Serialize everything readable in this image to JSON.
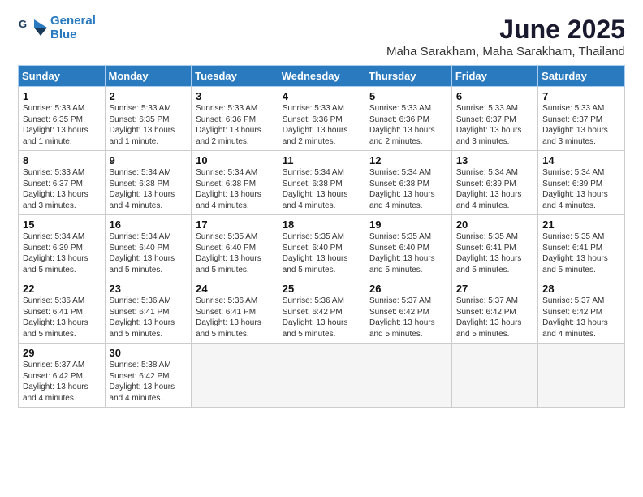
{
  "logo": {
    "line1": "General",
    "line2": "Blue"
  },
  "title": "June 2025",
  "location": "Maha Sarakham, Maha Sarakham, Thailand",
  "headers": [
    "Sunday",
    "Monday",
    "Tuesday",
    "Wednesday",
    "Thursday",
    "Friday",
    "Saturday"
  ],
  "weeks": [
    [
      {
        "day": "1",
        "detail": "Sunrise: 5:33 AM\nSunset: 6:35 PM\nDaylight: 13 hours\nand 1 minute."
      },
      {
        "day": "2",
        "detail": "Sunrise: 5:33 AM\nSunset: 6:35 PM\nDaylight: 13 hours\nand 1 minute."
      },
      {
        "day": "3",
        "detail": "Sunrise: 5:33 AM\nSunset: 6:36 PM\nDaylight: 13 hours\nand 2 minutes."
      },
      {
        "day": "4",
        "detail": "Sunrise: 5:33 AM\nSunset: 6:36 PM\nDaylight: 13 hours\nand 2 minutes."
      },
      {
        "day": "5",
        "detail": "Sunrise: 5:33 AM\nSunset: 6:36 PM\nDaylight: 13 hours\nand 2 minutes."
      },
      {
        "day": "6",
        "detail": "Sunrise: 5:33 AM\nSunset: 6:37 PM\nDaylight: 13 hours\nand 3 minutes."
      },
      {
        "day": "7",
        "detail": "Sunrise: 5:33 AM\nSunset: 6:37 PM\nDaylight: 13 hours\nand 3 minutes."
      }
    ],
    [
      {
        "day": "8",
        "detail": "Sunrise: 5:33 AM\nSunset: 6:37 PM\nDaylight: 13 hours\nand 3 minutes."
      },
      {
        "day": "9",
        "detail": "Sunrise: 5:34 AM\nSunset: 6:38 PM\nDaylight: 13 hours\nand 4 minutes."
      },
      {
        "day": "10",
        "detail": "Sunrise: 5:34 AM\nSunset: 6:38 PM\nDaylight: 13 hours\nand 4 minutes."
      },
      {
        "day": "11",
        "detail": "Sunrise: 5:34 AM\nSunset: 6:38 PM\nDaylight: 13 hours\nand 4 minutes."
      },
      {
        "day": "12",
        "detail": "Sunrise: 5:34 AM\nSunset: 6:38 PM\nDaylight: 13 hours\nand 4 minutes."
      },
      {
        "day": "13",
        "detail": "Sunrise: 5:34 AM\nSunset: 6:39 PM\nDaylight: 13 hours\nand 4 minutes."
      },
      {
        "day": "14",
        "detail": "Sunrise: 5:34 AM\nSunset: 6:39 PM\nDaylight: 13 hours\nand 4 minutes."
      }
    ],
    [
      {
        "day": "15",
        "detail": "Sunrise: 5:34 AM\nSunset: 6:39 PM\nDaylight: 13 hours\nand 5 minutes."
      },
      {
        "day": "16",
        "detail": "Sunrise: 5:34 AM\nSunset: 6:40 PM\nDaylight: 13 hours\nand 5 minutes."
      },
      {
        "day": "17",
        "detail": "Sunrise: 5:35 AM\nSunset: 6:40 PM\nDaylight: 13 hours\nand 5 minutes."
      },
      {
        "day": "18",
        "detail": "Sunrise: 5:35 AM\nSunset: 6:40 PM\nDaylight: 13 hours\nand 5 minutes."
      },
      {
        "day": "19",
        "detail": "Sunrise: 5:35 AM\nSunset: 6:40 PM\nDaylight: 13 hours\nand 5 minutes."
      },
      {
        "day": "20",
        "detail": "Sunrise: 5:35 AM\nSunset: 6:41 PM\nDaylight: 13 hours\nand 5 minutes."
      },
      {
        "day": "21",
        "detail": "Sunrise: 5:35 AM\nSunset: 6:41 PM\nDaylight: 13 hours\nand 5 minutes."
      }
    ],
    [
      {
        "day": "22",
        "detail": "Sunrise: 5:36 AM\nSunset: 6:41 PM\nDaylight: 13 hours\nand 5 minutes."
      },
      {
        "day": "23",
        "detail": "Sunrise: 5:36 AM\nSunset: 6:41 PM\nDaylight: 13 hours\nand 5 minutes."
      },
      {
        "day": "24",
        "detail": "Sunrise: 5:36 AM\nSunset: 6:41 PM\nDaylight: 13 hours\nand 5 minutes."
      },
      {
        "day": "25",
        "detail": "Sunrise: 5:36 AM\nSunset: 6:42 PM\nDaylight: 13 hours\nand 5 minutes."
      },
      {
        "day": "26",
        "detail": "Sunrise: 5:37 AM\nSunset: 6:42 PM\nDaylight: 13 hours\nand 5 minutes."
      },
      {
        "day": "27",
        "detail": "Sunrise: 5:37 AM\nSunset: 6:42 PM\nDaylight: 13 hours\nand 5 minutes."
      },
      {
        "day": "28",
        "detail": "Sunrise: 5:37 AM\nSunset: 6:42 PM\nDaylight: 13 hours\nand 4 minutes."
      }
    ],
    [
      {
        "day": "29",
        "detail": "Sunrise: 5:37 AM\nSunset: 6:42 PM\nDaylight: 13 hours\nand 4 minutes."
      },
      {
        "day": "30",
        "detail": "Sunrise: 5:38 AM\nSunset: 6:42 PM\nDaylight: 13 hours\nand 4 minutes."
      },
      {
        "day": "",
        "detail": ""
      },
      {
        "day": "",
        "detail": ""
      },
      {
        "day": "",
        "detail": ""
      },
      {
        "day": "",
        "detail": ""
      },
      {
        "day": "",
        "detail": ""
      }
    ]
  ]
}
